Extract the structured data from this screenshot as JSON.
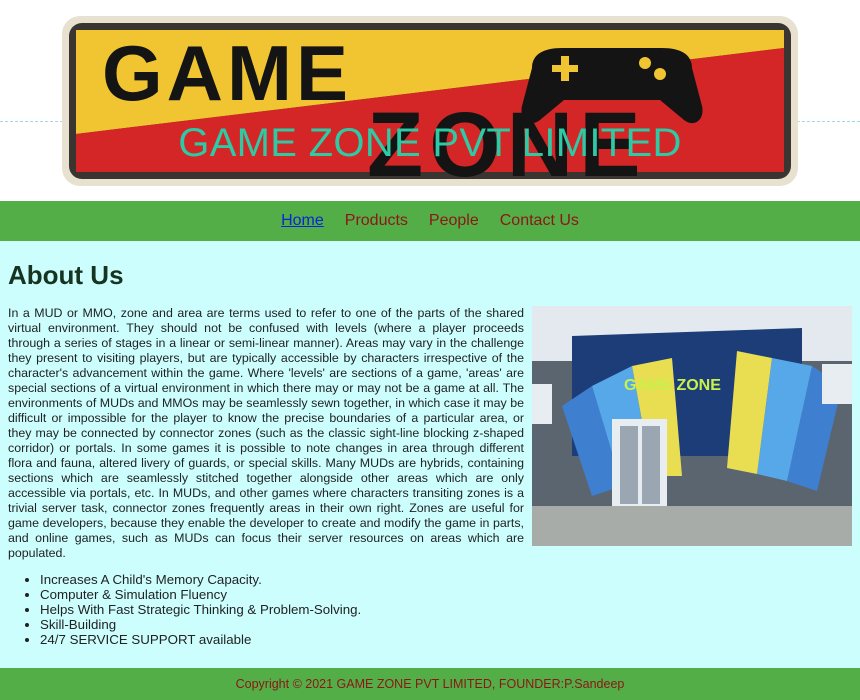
{
  "banner": {
    "company_name": "GAME ZONE PVT LIMITED",
    "logo_text_line1": "GAME",
    "logo_text_line2": "ZONE"
  },
  "nav": {
    "items": [
      {
        "label": "Home",
        "active": true
      },
      {
        "label": "Products",
        "active": false
      },
      {
        "label": "People",
        "active": false
      },
      {
        "label": "Contact Us",
        "active": false
      }
    ]
  },
  "about": {
    "heading": "About Us",
    "paragraph": "In a MUD or MMO, zone and area are terms used to refer to one of the parts of the shared virtual environment. They should not be confused with levels (where a player proceeds through a series of stages in a linear or semi-linear manner). Areas may vary in the challenge they present to visiting players, but are typically accessible by characters irrespective of the character's advancement within the game. Where 'levels' are sections of a game, 'areas' are special sections of a virtual environment in which there may or may not be a game at all. The environments of MUDs and MMOs may be seamlessly sewn together, in which case it may be difficult or impossible for the player to know the precise boundaries of a particular area, or they may be connected by connector zones (such as the classic sight-line blocking z-shaped corridor) or portals. In some games it is possible to note changes in area through different flora and fauna, altered livery of guards, or special skills. Many MUDs are hybrids, containing sections which are seamlessly stitched together alongside other areas which are only accessible via portals, etc. In MUDs, and other games where characters transiting zones is a trivial server task, connector zones frequently areas in their own right. Zones are useful for game developers, because they enable the developer to create and modify the game in parts, and online games, such as MUDs can focus their server resources on areas which are populated.",
    "photo_sign_text": "GAME ZONE",
    "features": [
      "Increases A Child's Memory Capacity.",
      "Computer & Simulation Fluency",
      "Helps With Fast Strategic Thinking & Problem-Solving.",
      "Skill-Building",
      "24/7 SERVICE SUPPORT available"
    ]
  },
  "footer": {
    "copyright": "Copyright © 2021 GAME ZONE PVT LIMITED, FOUNDER:P.Sandeep"
  },
  "colors": {
    "nav_bg": "#54ae47",
    "content_bg": "#ccfefe",
    "title_color": "#2ec9a5",
    "link_color": "#8b1717",
    "active_link": "#0b25d6"
  }
}
